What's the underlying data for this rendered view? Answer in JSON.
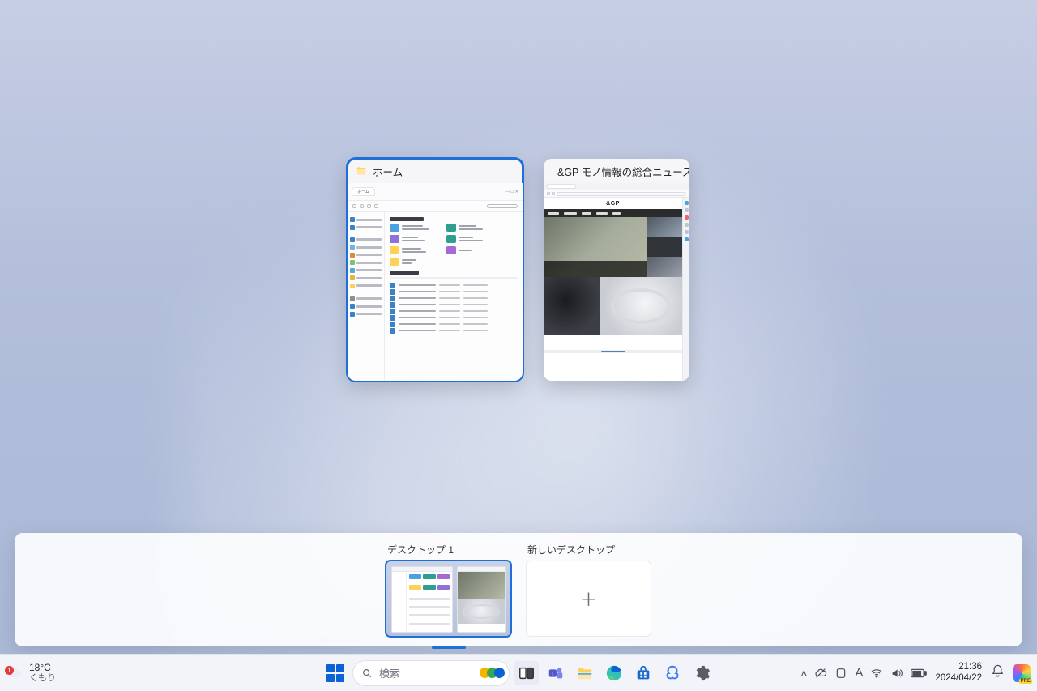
{
  "taskview": {
    "windows": [
      {
        "title": "ホーム",
        "app": "explorer",
        "active": true
      },
      {
        "title": "&GP モノ情報の総合ニュースサイ...",
        "app": "edge",
        "active": false
      }
    ]
  },
  "virtual_desktops": {
    "current": {
      "label": "デスクトップ 1"
    },
    "new": {
      "label": "新しいデスクトップ"
    }
  },
  "weather": {
    "badge": "1",
    "temp": "18°C",
    "condition": "くもり"
  },
  "search": {
    "placeholder": "検索"
  },
  "clock": {
    "time": "21:36",
    "date": "2024/04/22"
  },
  "colors": {
    "accent": "#1e6fd9"
  }
}
